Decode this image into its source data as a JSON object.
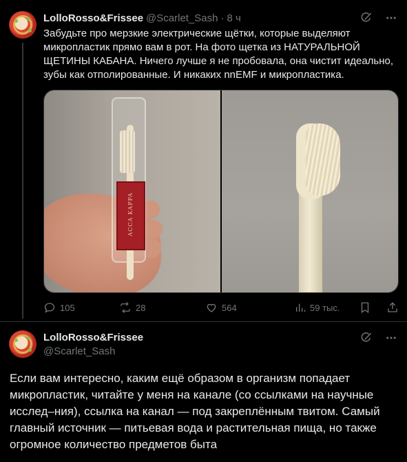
{
  "tweet1": {
    "name": "LolloRosso&Frissee",
    "handle": "@Scarlet_Sash",
    "separator": "·",
    "time": "8 ч",
    "text": "Забудьте про мерзкие электрические щётки, которые выделяют микропластик прямо вам в рот. На фото щетка из НАТУРАЛЬНОЙ ЩЕТИНЫ КАБАНА. Ничего лучше я не пробовала, она чистит идеально, зубы как отполированные. И никаких nnEMF и микропластика.",
    "photo_label": "ACCA KAPPA",
    "stats": {
      "replies": "105",
      "reposts": "28",
      "likes": "564",
      "views": "59 тыс."
    }
  },
  "tweet2": {
    "name": "LolloRosso&Frissee",
    "handle": "@Scarlet_Sash",
    "text": "Если вам интересно, каким ещё образом в организм попадает микропластик, читайте у меня на канале (со ссылками на научные исслед–ния), ссылка на канал — под закреплённым твитом. Самый главный источник — питьевая вода и растительная пища, но также огромное количество предметов быта"
  },
  "icons": [
    "grok-icon",
    "more-icon",
    "reply-icon",
    "repost-icon",
    "like-icon",
    "views-icon",
    "bookmark-icon",
    "share-icon"
  ],
  "colors": {
    "background": "#000000",
    "text": "#e7e9ea",
    "muted": "#71767b",
    "border": "#2f3336"
  }
}
